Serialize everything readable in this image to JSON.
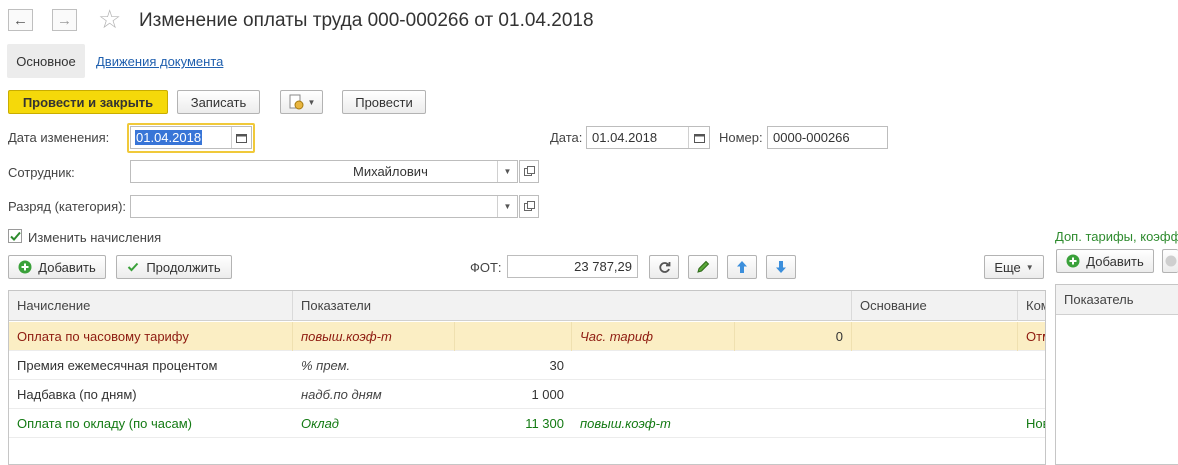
{
  "window": {
    "title": "Изменение оплаты труда 000-000266 от 01.04.2018",
    "back_icon": "←",
    "forward_icon": "→",
    "star_icon": "☆"
  },
  "tabs": {
    "main": "Основное",
    "movements": "Движения документа"
  },
  "toolbar": {
    "post_close": "Провести и закрыть",
    "save": "Записать",
    "post": "Провести",
    "more": "Еще"
  },
  "form": {
    "change_date_label": "Дата изменения:",
    "change_date_value": "01.04.2018",
    "date_label": "Дата:",
    "date_value": "01.04.2018",
    "number_label": "Номер:",
    "number_value": "0000-000266",
    "employee_label": "Сотрудник:",
    "employee_value": "Михайлович",
    "grade_label": "Разряд (категория):",
    "grade_value": "",
    "change_accruals_label": "Изменить начисления",
    "change_accruals_checked": true
  },
  "accruals_toolbar": {
    "add": "Добавить",
    "continue": "Продолжить",
    "fot_label": "ФОТ:",
    "fot_value": "23 787,29"
  },
  "table": {
    "headers": [
      "Начисление",
      "Показатели",
      "Основание",
      "Ком"
    ],
    "rows": [
      {
        "accrual": "Оплата по часовому тарифу",
        "ind1": "повыш.коэф-т",
        "val1": "",
        "ind2": "Час. тариф",
        "val2": "0",
        "basis": "",
        "comment": "Отм",
        "style": "selected"
      },
      {
        "accrual": "Премия ежемесячная процентом",
        "ind1": "% прем.",
        "val1": "30",
        "ind2": "",
        "val2": "",
        "basis": "",
        "comment": "",
        "style": "normal"
      },
      {
        "accrual": "Надбавка (по дням)",
        "ind1": "надб.по дням",
        "val1": "1 000",
        "ind2": "",
        "val2": "",
        "basis": "",
        "comment": "",
        "style": "normal"
      },
      {
        "accrual": "Оплата по окладу (по часам)",
        "ind1": "Оклад",
        "val1": "11 300",
        "ind2": "повыш.коэф-т",
        "val2": "",
        "basis": "",
        "comment": "Нов",
        "style": "green"
      }
    ]
  },
  "side_panel": {
    "title": "Доп. тарифы, коэфф",
    "add": "Добавить",
    "header": "Показатель"
  },
  "colors": {
    "accent_yellow": "#f5d90a",
    "link_blue": "#1f5fae",
    "red_text": "#8e1b10",
    "green_text": "#137a13",
    "selected_row": "#fbeec4"
  }
}
